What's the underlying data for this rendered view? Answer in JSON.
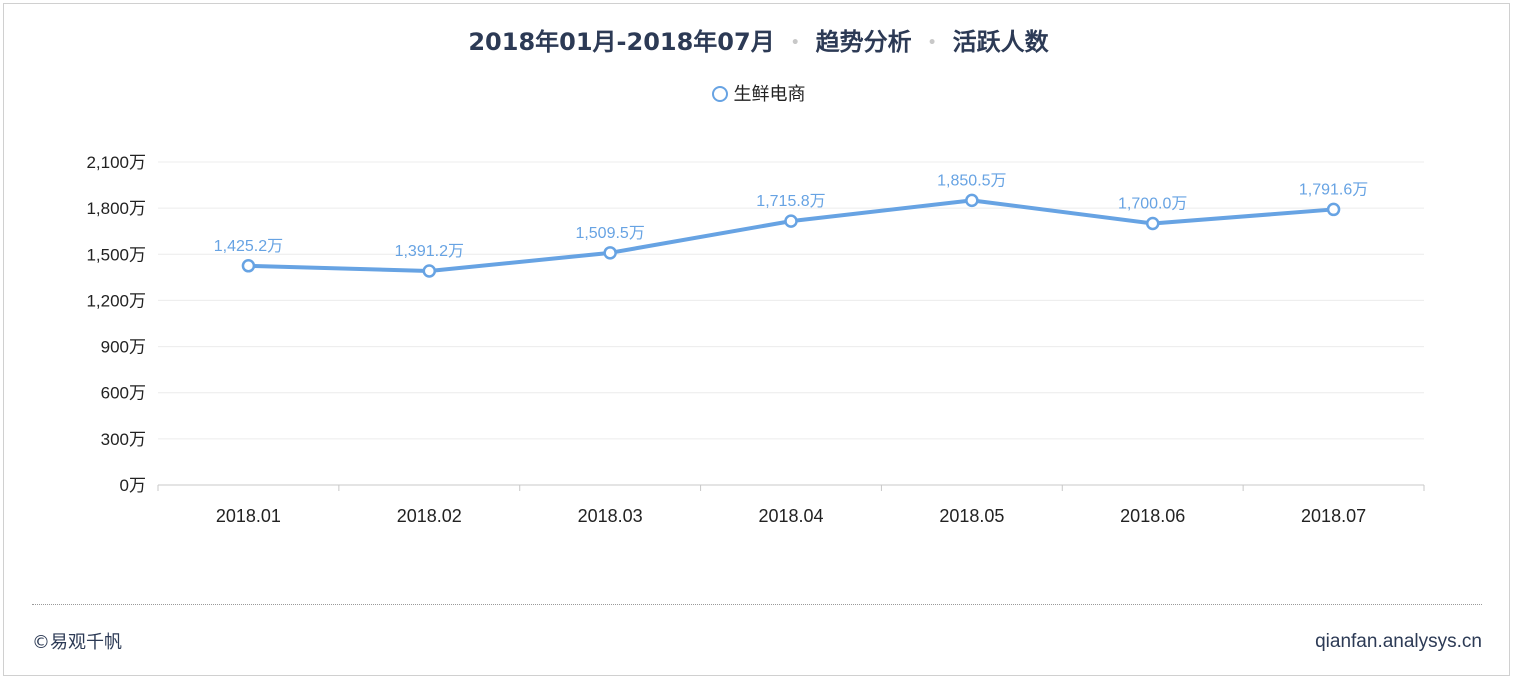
{
  "title": {
    "period": "2018年01月-2018年07月",
    "sep": "•",
    "analysis": "趋势分析",
    "metric": "活跃人数"
  },
  "footer": {
    "copyright": "©易观千帆",
    "url": "qianfan.analysys.cn"
  },
  "colors": {
    "series": "#67a3e3",
    "title": "#2c3a55"
  },
  "chart_data": {
    "type": "line",
    "categories": [
      "2018.01",
      "2018.02",
      "2018.03",
      "2018.04",
      "2018.05",
      "2018.06",
      "2018.07"
    ],
    "series": [
      {
        "name": "生鲜电商",
        "values": [
          1425.2,
          1391.2,
          1509.5,
          1715.8,
          1850.5,
          1700.0,
          1791.6
        ],
        "labels": [
          "1,425.2万",
          "1,391.2万",
          "1,509.5万",
          "1,715.8万",
          "1,850.5万",
          "1,700.0万",
          "1,791.6万"
        ]
      }
    ],
    "ylim": [
      0,
      2100
    ],
    "yticks": [
      0,
      300,
      600,
      900,
      1200,
      1500,
      1800,
      2100
    ],
    "ytick_labels": [
      "0万",
      "300万",
      "600万",
      "900万",
      "1,200万",
      "1,500万",
      "1,800万",
      "2,100万"
    ],
    "grid": true,
    "legend": "top-center"
  }
}
